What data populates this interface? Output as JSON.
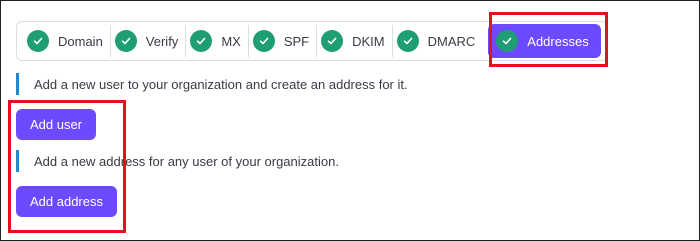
{
  "steps": [
    {
      "label": "Domain",
      "status": "done"
    },
    {
      "label": "Verify",
      "status": "done"
    },
    {
      "label": "MX",
      "status": "done"
    },
    {
      "label": "SPF",
      "status": "done"
    },
    {
      "label": "DKIM",
      "status": "done"
    },
    {
      "label": "DMARC",
      "status": "done"
    },
    {
      "label": "Addresses",
      "status": "active"
    }
  ],
  "notes": {
    "add_user": "Add a new user to your organization and create an address for it.",
    "add_address": "Add a new address for any user of your organization."
  },
  "buttons": {
    "add_user": "Add user",
    "add_address": "Add address"
  },
  "colors": {
    "accent": "#6d4aff",
    "check": "#1f9d75",
    "note_bar": "#1d8ad6",
    "highlight": "#e0121e"
  }
}
